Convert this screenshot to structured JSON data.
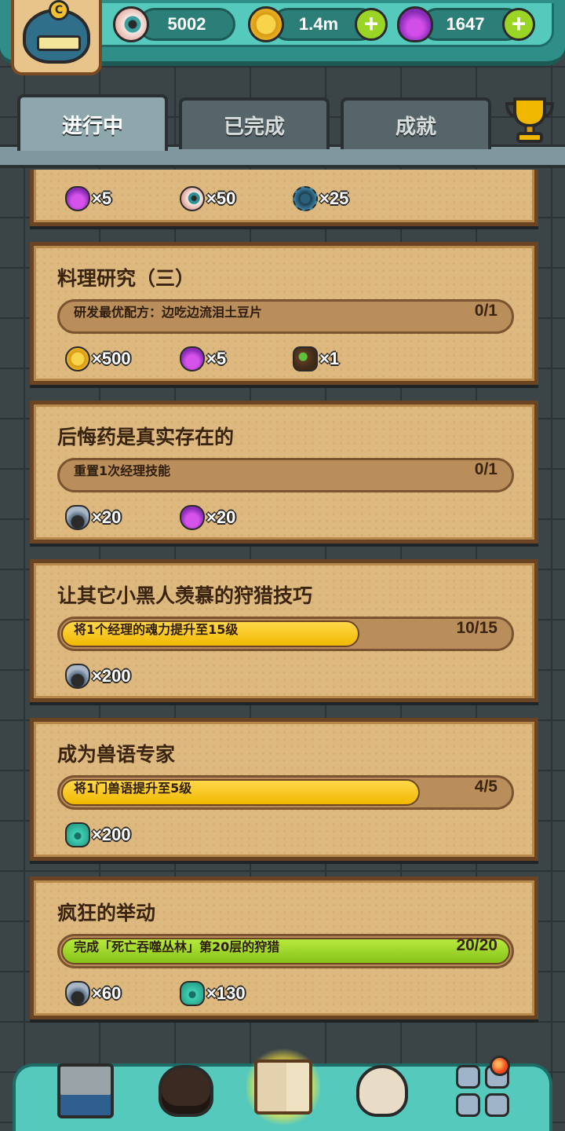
{
  "resources": [
    {
      "icon": "eye-icon",
      "value": "5002",
      "addable": false
    },
    {
      "icon": "coin-icon",
      "value": "1.4m",
      "addable": true
    },
    {
      "icon": "potion-icon",
      "value": "1647",
      "addable": true
    }
  ],
  "tabs": [
    {
      "label": "进行中",
      "active": true
    },
    {
      "label": "已完成",
      "active": false
    },
    {
      "label": "成就",
      "active": false
    }
  ],
  "partial_card": {
    "rewards": [
      {
        "icon": "potion-icon",
        "text": "×5"
      },
      {
        "icon": "eye-icon",
        "text": "×50"
      },
      {
        "icon": "gear-icon",
        "text": "×25"
      }
    ]
  },
  "quests": [
    {
      "title": "料理研究（三）",
      "task": "研发最优配方：边吃边流泪土豆片",
      "progress": "0/1",
      "current": 0,
      "total": 1,
      "bar_color": "none",
      "rewards": [
        {
          "icon": "coin-icon",
          "text": "×500"
        },
        {
          "icon": "potion-icon",
          "text": "×5"
        },
        {
          "icon": "ore-icon",
          "text": "×1"
        }
      ]
    },
    {
      "title": "后悔药是真实存在的",
      "task": "重置1次经理技能",
      "progress": "0/1",
      "current": 0,
      "total": 1,
      "bar_color": "none",
      "rewards": [
        {
          "icon": "soul-key-icon",
          "text": "×20"
        },
        {
          "icon": "potion-icon",
          "text": "×20"
        }
      ]
    },
    {
      "title": "让其它小黑人羡慕的狩猎技巧",
      "task": "将1个经理的魂力提升至15级",
      "progress": "10/15",
      "current": 10,
      "total": 15,
      "bar_color": "yellow",
      "rewards": [
        {
          "icon": "soul-key-icon",
          "text": "×200"
        }
      ]
    },
    {
      "title": "成为兽语专家",
      "task": "将1门兽语提升至5级",
      "progress": "4/5",
      "current": 4,
      "total": 5,
      "bar_color": "yellow",
      "rewards": [
        {
          "icon": "beast-icon",
          "text": "×200"
        }
      ]
    },
    {
      "title": "疯狂的举动",
      "task": "完成「死亡吞噬丛林」第20层的狩猎",
      "progress": "20/20",
      "current": 20,
      "total": 20,
      "bar_color": "green",
      "rewards": [
        {
          "icon": "soul-key-icon",
          "text": "×60"
        },
        {
          "icon": "beast-icon",
          "text": "×130"
        }
      ]
    }
  ],
  "bottom_nav": [
    {
      "icon": "shop-icon",
      "active": false
    },
    {
      "icon": "monster-icon",
      "active": false
    },
    {
      "icon": "quest-book-icon",
      "active": true
    },
    {
      "icon": "money-bag-icon",
      "active": false
    },
    {
      "icon": "menu-grid-icon",
      "active": false,
      "notification": true
    }
  ]
}
